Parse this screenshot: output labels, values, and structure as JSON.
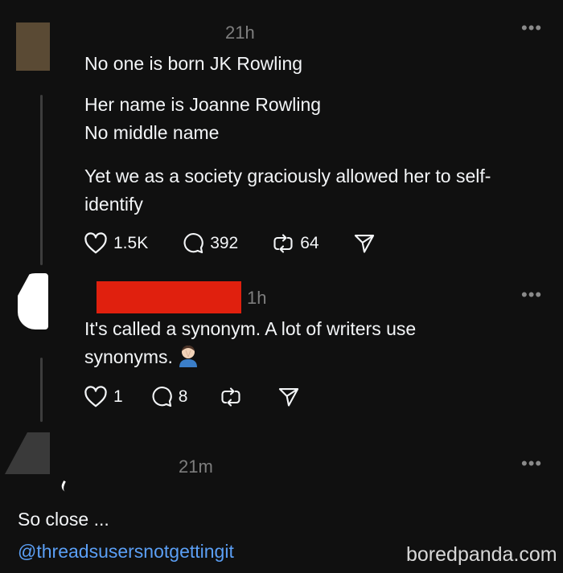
{
  "posts": [
    {
      "time": "21h",
      "text_lines": [
        "No one is born JK Rowling",
        "Her name is Joanne Rowling\nNo middle name",
        "Yet we as a society graciously allowed her to self-\nidentify"
      ],
      "likes": "1.5K",
      "replies": "392",
      "reposts": "64"
    },
    {
      "time": "1h",
      "text": "It's called a synonym. A lot of writers use\nsynonyms.",
      "likes": "1",
      "replies": "8"
    },
    {
      "time": "21m"
    }
  ],
  "footer": {
    "caption": "So close ...",
    "link": "@threadsusersnotgettingit",
    "watermark": "boredpanda.com"
  },
  "icons": {
    "like": "heart-icon",
    "reply": "comment-icon",
    "repost": "repost-icon",
    "share": "share-icon",
    "more": "more-icon",
    "emoji": "facepalm-emoji"
  },
  "colors": {
    "background": "#101010",
    "text": "#f3f5f7",
    "muted": "#7e7e7e",
    "link": "#5b9ff5",
    "redaction": "#e0200e"
  }
}
